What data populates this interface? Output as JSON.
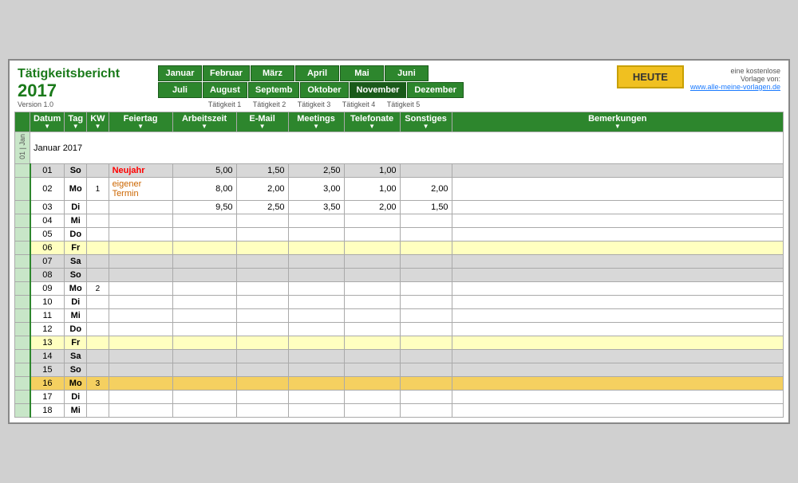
{
  "app": {
    "title": "Tätigkeitsbericht",
    "year": "2017",
    "version": "Version 1.0",
    "info_line1": "eine kostenlose",
    "info_line2": "Vorlage von:",
    "info_link": "www.alle-meine-vorlagen.de"
  },
  "navigation": {
    "months_row1": [
      "Januar",
      "Februar",
      "März",
      "April",
      "Mai",
      "Juni"
    ],
    "months_row2": [
      "Juli",
      "August",
      "Septemb",
      "Oktober",
      "November",
      "Dezember"
    ],
    "taetigkeiten_row1": [
      "",
      "Tätigkeit 1",
      "Tätigkeit 2",
      "Tätigkeit 3",
      "Tätigkeit 4",
      "Tätigkeit 5"
    ],
    "heute_label": "HEUTE",
    "active_month": "November"
  },
  "table": {
    "headers": {
      "datum": "Datum",
      "tag": "Tag",
      "kw": "KW",
      "feiertag": "Feiertag",
      "arbeitszeit": "Arbeitszeit",
      "email": "E-Mail",
      "meetings": "Meetings",
      "telefonate": "Telefonate",
      "sonstiges": "Sonstiges",
      "bemerkungen": "Bemerkungen"
    },
    "month_title": "Januar 2017",
    "rows": [
      {
        "datum": "01",
        "tag": "So",
        "kw": "",
        "feiertag": "Neujahr",
        "arbeitszeit": "5,00",
        "email": "1,50",
        "meetings": "2,50",
        "telefonate": "1,00",
        "sonstiges": "",
        "bemerkungen": "",
        "type": "weekend",
        "holiday": true
      },
      {
        "datum": "02",
        "tag": "Mo",
        "kw": "1",
        "feiertag": "eigener Termin",
        "arbeitszeit": "8,00",
        "email": "2,00",
        "meetings": "3,00",
        "telefonate": "1,00",
        "sonstiges": "2,00",
        "bemerkungen": "",
        "type": "normal",
        "eigener": true
      },
      {
        "datum": "03",
        "tag": "Di",
        "kw": "",
        "feiertag": "",
        "arbeitszeit": "9,50",
        "email": "2,50",
        "meetings": "3,50",
        "telefonate": "2,00",
        "sonstiges": "1,50",
        "bemerkungen": "",
        "type": "normal"
      },
      {
        "datum": "04",
        "tag": "Mi",
        "kw": "",
        "feiertag": "",
        "arbeitszeit": "",
        "email": "",
        "meetings": "",
        "telefonate": "",
        "sonstiges": "",
        "bemerkungen": "",
        "type": "normal"
      },
      {
        "datum": "05",
        "tag": "Do",
        "kw": "",
        "feiertag": "",
        "arbeitszeit": "",
        "email": "",
        "meetings": "",
        "telefonate": "",
        "sonstiges": "",
        "bemerkungen": "",
        "type": "normal"
      },
      {
        "datum": "06",
        "tag": "Fr",
        "kw": "",
        "feiertag": "",
        "arbeitszeit": "",
        "email": "",
        "meetings": "",
        "telefonate": "",
        "sonstiges": "",
        "bemerkungen": "",
        "type": "highlight-yellow"
      },
      {
        "datum": "07",
        "tag": "Sa",
        "kw": "",
        "feiertag": "",
        "arbeitszeit": "",
        "email": "",
        "meetings": "",
        "telefonate": "",
        "sonstiges": "",
        "bemerkungen": "",
        "type": "weekend"
      },
      {
        "datum": "08",
        "tag": "So",
        "kw": "",
        "feiertag": "",
        "arbeitszeit": "",
        "email": "",
        "meetings": "",
        "telefonate": "",
        "sonstiges": "",
        "bemerkungen": "",
        "type": "weekend"
      },
      {
        "datum": "09",
        "tag": "Mo",
        "kw": "2",
        "feiertag": "",
        "arbeitszeit": "",
        "email": "",
        "meetings": "",
        "telefonate": "",
        "sonstiges": "",
        "bemerkungen": "",
        "type": "normal"
      },
      {
        "datum": "10",
        "tag": "Di",
        "kw": "",
        "feiertag": "",
        "arbeitszeit": "",
        "email": "",
        "meetings": "",
        "telefonate": "",
        "sonstiges": "",
        "bemerkungen": "",
        "type": "normal"
      },
      {
        "datum": "11",
        "tag": "Mi",
        "kw": "",
        "feiertag": "",
        "arbeitszeit": "",
        "email": "",
        "meetings": "",
        "telefonate": "",
        "sonstiges": "",
        "bemerkungen": "",
        "type": "normal"
      },
      {
        "datum": "12",
        "tag": "Do",
        "kw": "",
        "feiertag": "",
        "arbeitszeit": "",
        "email": "",
        "meetings": "",
        "telefonate": "",
        "sonstiges": "",
        "bemerkungen": "",
        "type": "normal"
      },
      {
        "datum": "13",
        "tag": "Fr",
        "kw": "",
        "feiertag": "",
        "arbeitszeit": "",
        "email": "",
        "meetings": "",
        "telefonate": "",
        "sonstiges": "",
        "bemerkungen": "",
        "type": "highlight-yellow"
      },
      {
        "datum": "14",
        "tag": "Sa",
        "kw": "",
        "feiertag": "",
        "arbeitszeit": "",
        "email": "",
        "meetings": "",
        "telefonate": "",
        "sonstiges": "",
        "bemerkungen": "",
        "type": "weekend"
      },
      {
        "datum": "15",
        "tag": "So",
        "kw": "",
        "feiertag": "",
        "arbeitszeit": "",
        "email": "",
        "meetings": "",
        "telefonate": "",
        "sonstiges": "",
        "bemerkungen": "",
        "type": "weekend"
      },
      {
        "datum": "16",
        "tag": "Mo",
        "kw": "3",
        "feiertag": "",
        "arbeitszeit": "",
        "email": "",
        "meetings": "",
        "telefonate": "",
        "sonstiges": "",
        "bemerkungen": "",
        "type": "highlight-gold"
      },
      {
        "datum": "17",
        "tag": "Di",
        "kw": "",
        "feiertag": "",
        "arbeitszeit": "",
        "email": "",
        "meetings": "",
        "telefonate": "",
        "sonstiges": "",
        "bemerkungen": "",
        "type": "normal"
      },
      {
        "datum": "18",
        "tag": "Mi",
        "kw": "",
        "feiertag": "",
        "arbeitszeit": "",
        "email": "",
        "meetings": "",
        "telefonate": "",
        "sonstiges": "",
        "bemerkungen": "",
        "type": "normal"
      }
    ]
  },
  "section_label": "01 | Jan"
}
